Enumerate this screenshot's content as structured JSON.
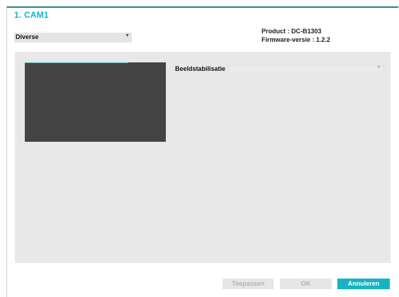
{
  "dialog": {
    "title": "1. CAM1"
  },
  "device": {
    "product": "Product : DC-B1303",
    "firmware": "Firmware-versie : 1.2.2"
  },
  "category_select": {
    "value": "Diverse",
    "chevron_icon": "chevron-down-icon"
  },
  "settings": {
    "image_stabilization_label": "Beeldstabilisatie",
    "image_stabilization_value": ""
  },
  "buttons": {
    "apply_label": "Toepassen",
    "ok_label": "OK",
    "cancel_label": "Annuleren"
  },
  "colors": {
    "accent": "#16b3c4",
    "header_border": "#2a7f86",
    "panel_bg": "#e8e8e8",
    "preview_bg": "#444444",
    "disabled_text": "#b3b3b3"
  }
}
